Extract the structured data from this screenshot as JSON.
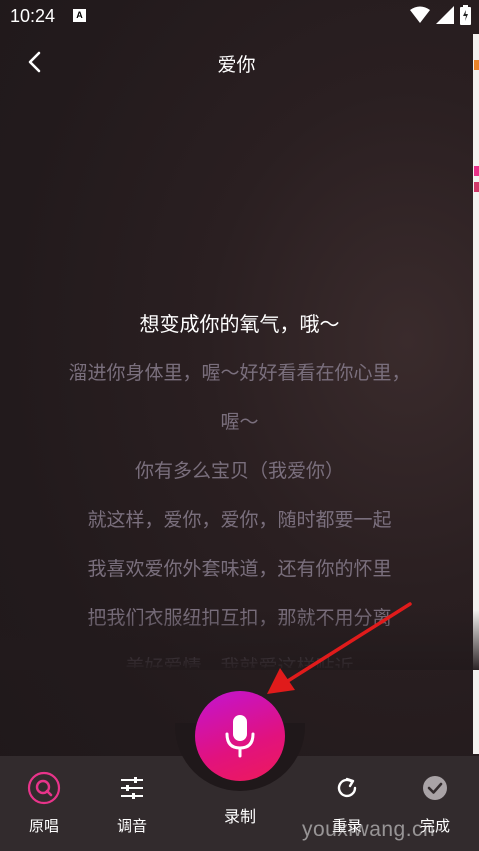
{
  "status_bar": {
    "time": "10:24",
    "badge": "A"
  },
  "header": {
    "title": "爱你"
  },
  "lyrics": [
    {
      "text": "想变成你的氧气，哦～",
      "current": true
    },
    {
      "text": "溜进你身体里，喔～好好看看在你心里，",
      "current": false
    },
    {
      "text": "喔～",
      "current": false
    },
    {
      "text": "你有多么宝贝（我爱你）",
      "current": false
    },
    {
      "text": "就这样，爱你，爱你，随时都要一起",
      "current": false
    },
    {
      "text": "我喜欢爱你外套味道，还有你的怀里",
      "current": false
    },
    {
      "text": "把我们衣服纽扣互扣，那就不用分离",
      "current": false
    },
    {
      "text": "美好爱情，我就爱这样贴近",
      "current": false
    }
  ],
  "toolbar": {
    "original_label": "原唱",
    "tune_label": "调音",
    "record_label": "录制",
    "rerecord_label": "重录",
    "done_label": "完成"
  },
  "watermark": "youxiwang.cn",
  "colors": {
    "accent_pink": "#e8348a",
    "mic_gradient_start": "#c214d2",
    "mic_gradient_end": "#ee1a5a",
    "annotation_arrow": "#e01b1b"
  }
}
